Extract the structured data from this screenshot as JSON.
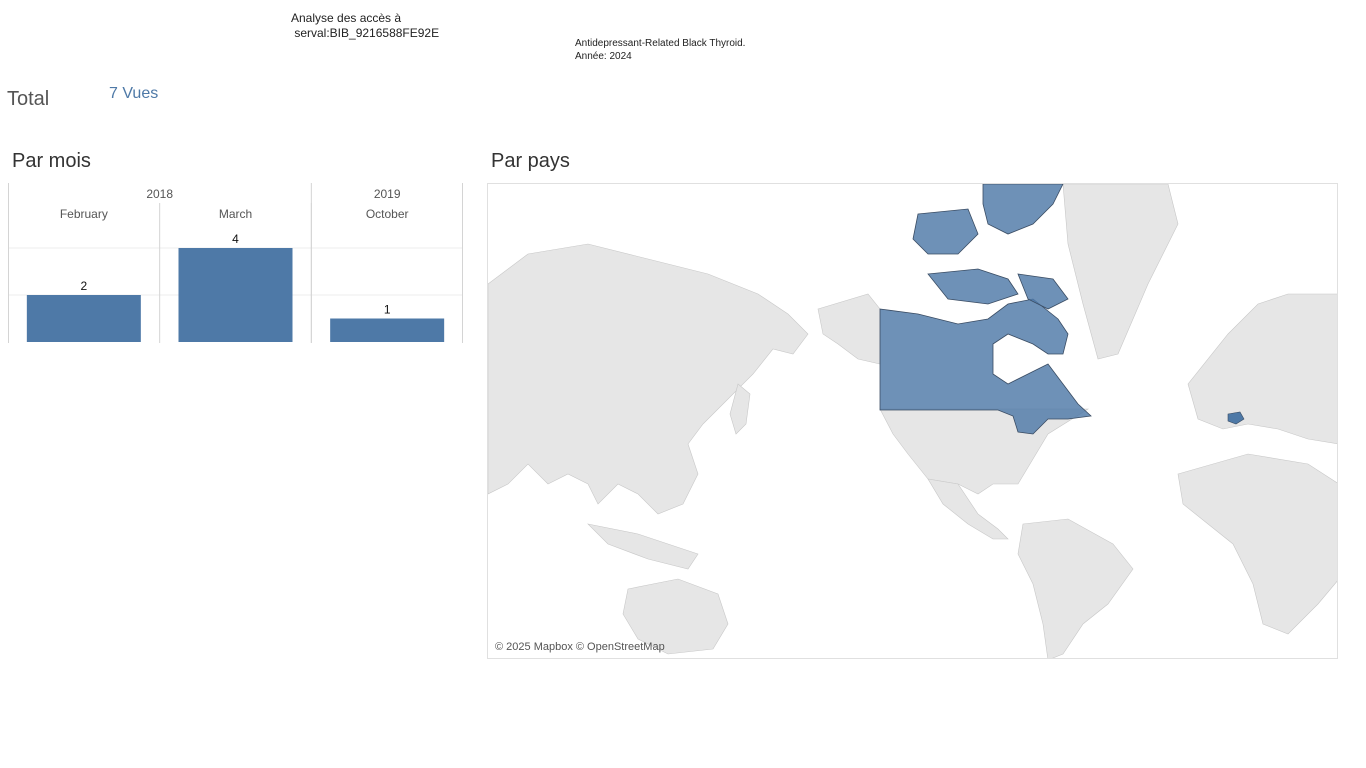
{
  "header": {
    "title": "Analyse des accès à\n serval:BIB_9216588FE92E",
    "doc": "Antidepressant-Related Black Thyroid.\nAnnée: 2024"
  },
  "total": {
    "label": "Total",
    "value": "7 Vues"
  },
  "sections": {
    "by_month": "Par mois",
    "by_country": "Par pays"
  },
  "chart_data": {
    "type": "bar",
    "years": [
      {
        "year": "2018",
        "months": [
          "February",
          "March"
        ]
      },
      {
        "year": "2019",
        "months": [
          "October"
        ]
      }
    ],
    "categories": [
      "February",
      "March",
      "October"
    ],
    "values": [
      2,
      4,
      1
    ],
    "ylim": [
      0,
      4
    ],
    "grid": true,
    "bar_color": "#4e79a7"
  },
  "map": {
    "credit": "© 2025 Mapbox © OpenStreetMap",
    "highlight_color": "#4e79a7",
    "land_color": "#e6e6e6"
  }
}
